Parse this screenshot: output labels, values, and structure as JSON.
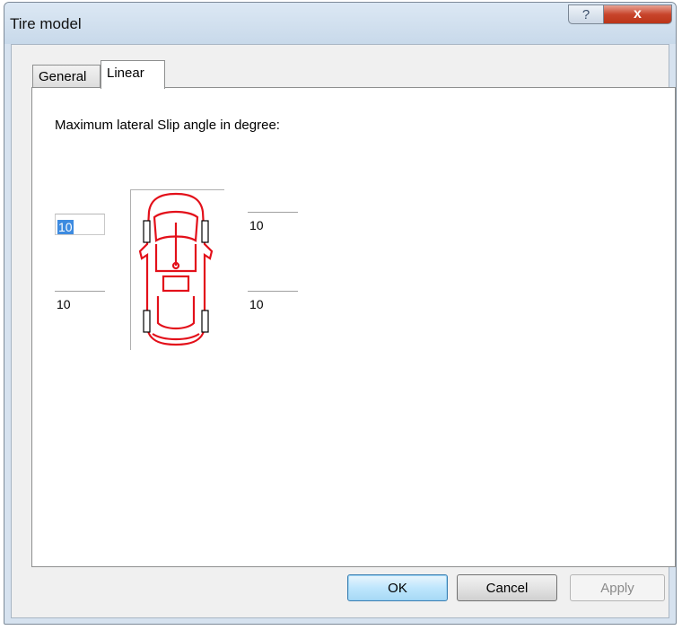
{
  "window": {
    "title": "Tire model",
    "help_glyph": "?",
    "close_glyph": "x"
  },
  "tabs": [
    {
      "label": "General",
      "active": false
    },
    {
      "label": "Linear",
      "active": true
    }
  ],
  "linear": {
    "heading": "Maximum lateral Slip angle in degree:",
    "front_left": "10",
    "front_right": "10",
    "rear_left": "10",
    "rear_right": "10"
  },
  "car_illustration": {
    "icon": "car-top-view-icon",
    "color": "#e3101a"
  },
  "buttons": {
    "ok": "OK",
    "cancel": "Cancel",
    "apply": "Apply"
  }
}
